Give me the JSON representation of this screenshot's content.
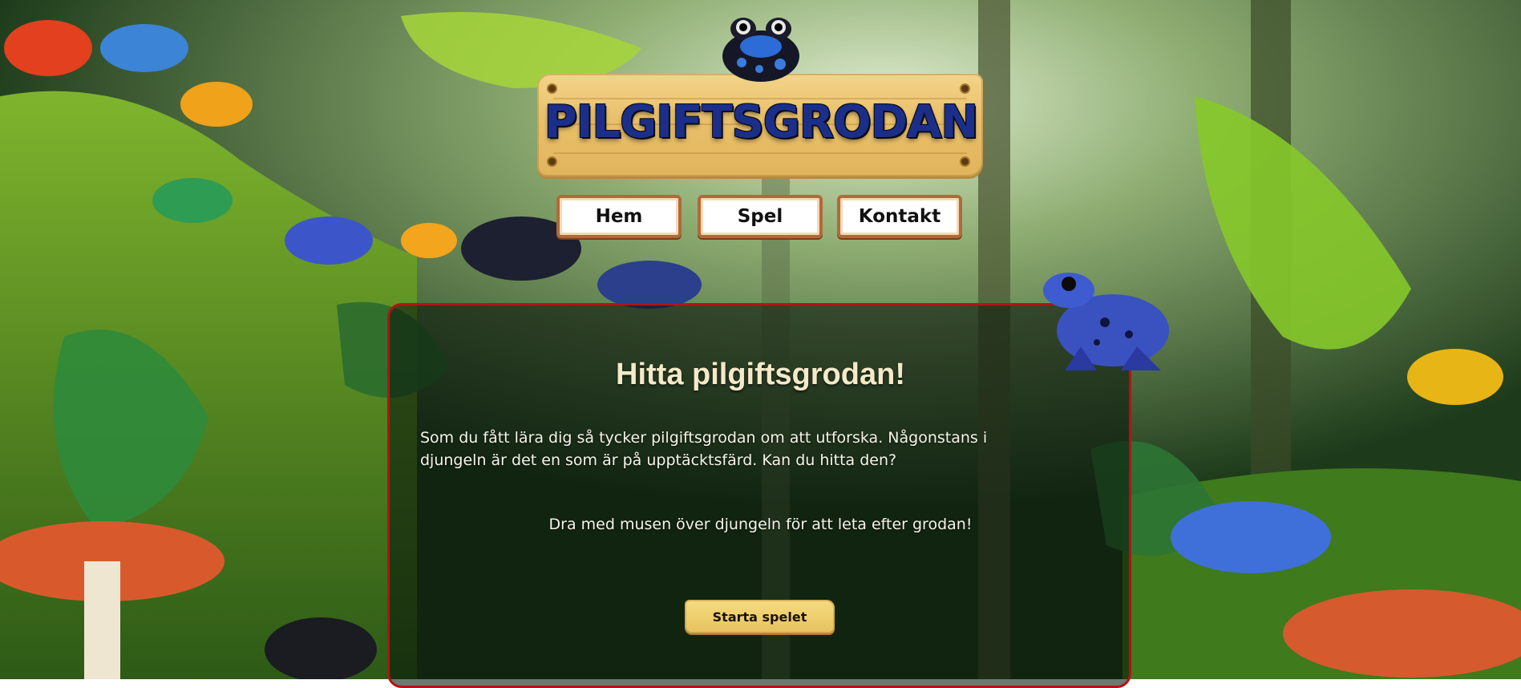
{
  "site": {
    "logo_text": "PILGIFTSGRODAN"
  },
  "nav": {
    "items": [
      {
        "label": "Hem"
      },
      {
        "label": "Spel"
      },
      {
        "label": "Kontakt"
      }
    ]
  },
  "game_panel": {
    "title": "Hitta pilgiftsgrodan!",
    "intro": "Som du fått lära dig så tycker pilgiftsgrodan om att utforska. Någonstans i djungeln är det en som är på upptäcktsfärd. Kan du hitta den?",
    "instruction": "Dra med musen över djungeln för att leta efter grodan!",
    "start_button": "Starta spelet"
  },
  "colors": {
    "panel_border": "#b31313",
    "title_text": "#f4e9c8",
    "plank": "#e9c06a",
    "nav_border": "#b06a3a"
  }
}
